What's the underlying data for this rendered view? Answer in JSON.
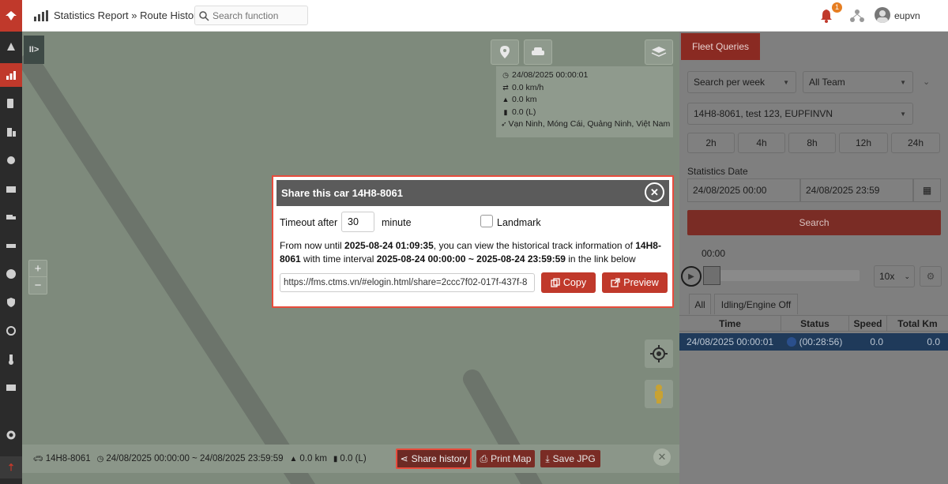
{
  "header": {
    "breadcrumb_parent": "Statistics Report",
    "breadcrumb_sep": "»",
    "breadcrumb_current": "Route History",
    "search_placeholder": "Search function",
    "notification_count": "1",
    "username": "eupvn"
  },
  "map": {
    "toggle_label": "II>",
    "info": {
      "datetime": "24/08/2025 00:00:01",
      "speed": "0.0 km/h",
      "distance": "0.0 km",
      "fuel": "0.0 (L)",
      "location": "Vạn Ninh, Móng Cái, Quảng Ninh, Việt Nam"
    },
    "zoom_in": "+",
    "zoom_out": "−"
  },
  "bottom_bar": {
    "plate": "14H8-8061",
    "range": "24/08/2025 00:00:00 ~ 24/08/2025 23:59:59",
    "distance": "0.0 km",
    "fuel": "0.0 (L)",
    "share_label": "Share history",
    "print_label": "Print Map",
    "save_label": "Save JPG",
    "close_label": "✕"
  },
  "right_panel": {
    "tab_label": "Fleet Queries",
    "period_select": "Search per week",
    "team_select": "All Team",
    "vehicle_select": "14H8-8061, test 123, EUPFINVN",
    "quick_ranges": [
      "2h",
      "4h",
      "8h",
      "12h",
      "24h"
    ],
    "stats_date_label": "Statistics Date",
    "date_from": "24/08/2025 00:00",
    "date_to": "24/08/2025 23:59",
    "search_label": "Search",
    "timer": "00:00",
    "speed_select": "10x",
    "subtabs": [
      "All",
      "Idling/Engine Off"
    ],
    "columns": [
      "Time",
      "Status",
      "Speed",
      "Total Km"
    ],
    "rows": [
      {
        "time": "24/08/2025 00:00:01",
        "status": "(00:28:56)",
        "speed": "0.0",
        "total_km": "0.0"
      }
    ]
  },
  "modal": {
    "title": "Share this car 14H8-8061",
    "close_label": "✕",
    "timeout_label": "Timeout after",
    "timeout_value": "30",
    "minute_label": "minute",
    "landmark_label": "Landmark",
    "desc_p1": "From now until ",
    "desc_until": "2025-08-24 01:09:35",
    "desc_p2": ", you can view the historical track information of ",
    "desc_plate": "14H8-8061",
    "desc_p3": " with time interval ",
    "desc_interval": "2025-08-24 00:00:00 ~ 2025-08-24 23:59:59",
    "desc_p4": " in the link below",
    "link_value": "https://fms.ctms.vn/#elogin.html/share=2ccc7f02-017f-437f-8",
    "copy_label": "Copy",
    "preview_label": "Preview"
  },
  "colors": {
    "accent": "#c0392b",
    "highlight_border": "#e74c3c",
    "modal_header": "#5b5b5b"
  }
}
